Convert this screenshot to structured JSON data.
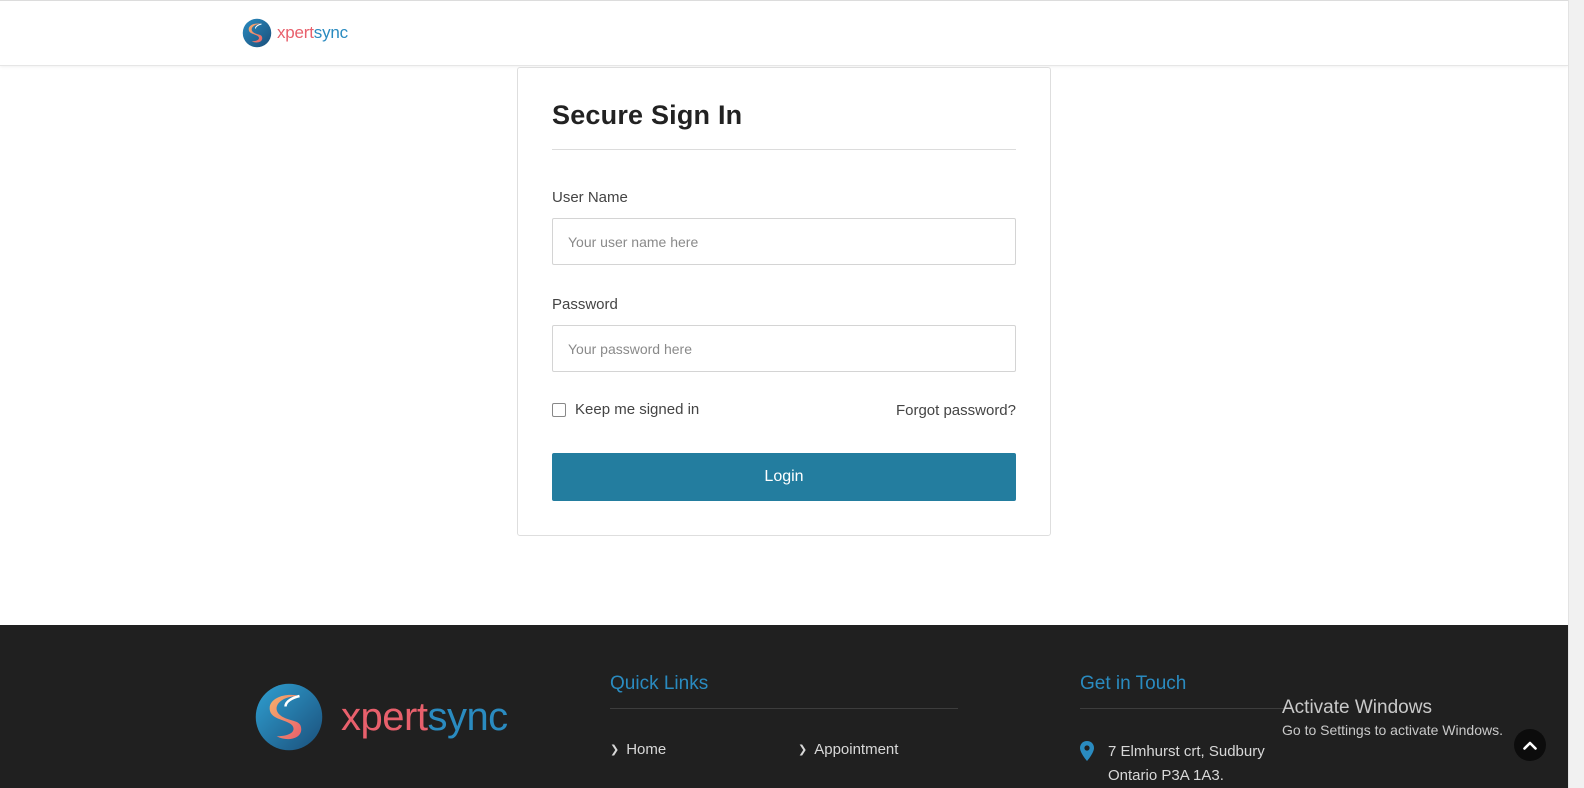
{
  "brand": {
    "part1": "xpert",
    "part2": "sync",
    "colors": {
      "pink": "#e8606c",
      "blue": "#2a8bc0"
    }
  },
  "login": {
    "title": "Secure Sign In",
    "username_label": "User Name",
    "username_placeholder": "Your user name here",
    "username_value": "",
    "password_label": "Password",
    "password_placeholder": "Your password here",
    "password_value": "",
    "remember_label": "Keep me signed in",
    "remember_checked": false,
    "forgot_label": "Forgot password?",
    "button_label": "Login",
    "button_color": "#237d9f"
  },
  "footer": {
    "background": "#202020",
    "quick_links": {
      "heading": "Quick Links",
      "items": [
        {
          "label": "Home",
          "icon": "chevron-right-icon"
        },
        {
          "label": "Appointment",
          "icon": "chevron-right-icon"
        }
      ]
    },
    "contact": {
      "heading": "Get in Touch",
      "icon": "map-pin-icon",
      "address_line1": "7 Elmhurst crt, Sudbury",
      "address_line2": "Ontario P3A 1A3."
    }
  },
  "watermark": {
    "line1": "Activate Windows",
    "line2": "Go to Settings to activate Windows."
  },
  "back_to_top": {
    "icon": "chevron-up-icon"
  }
}
